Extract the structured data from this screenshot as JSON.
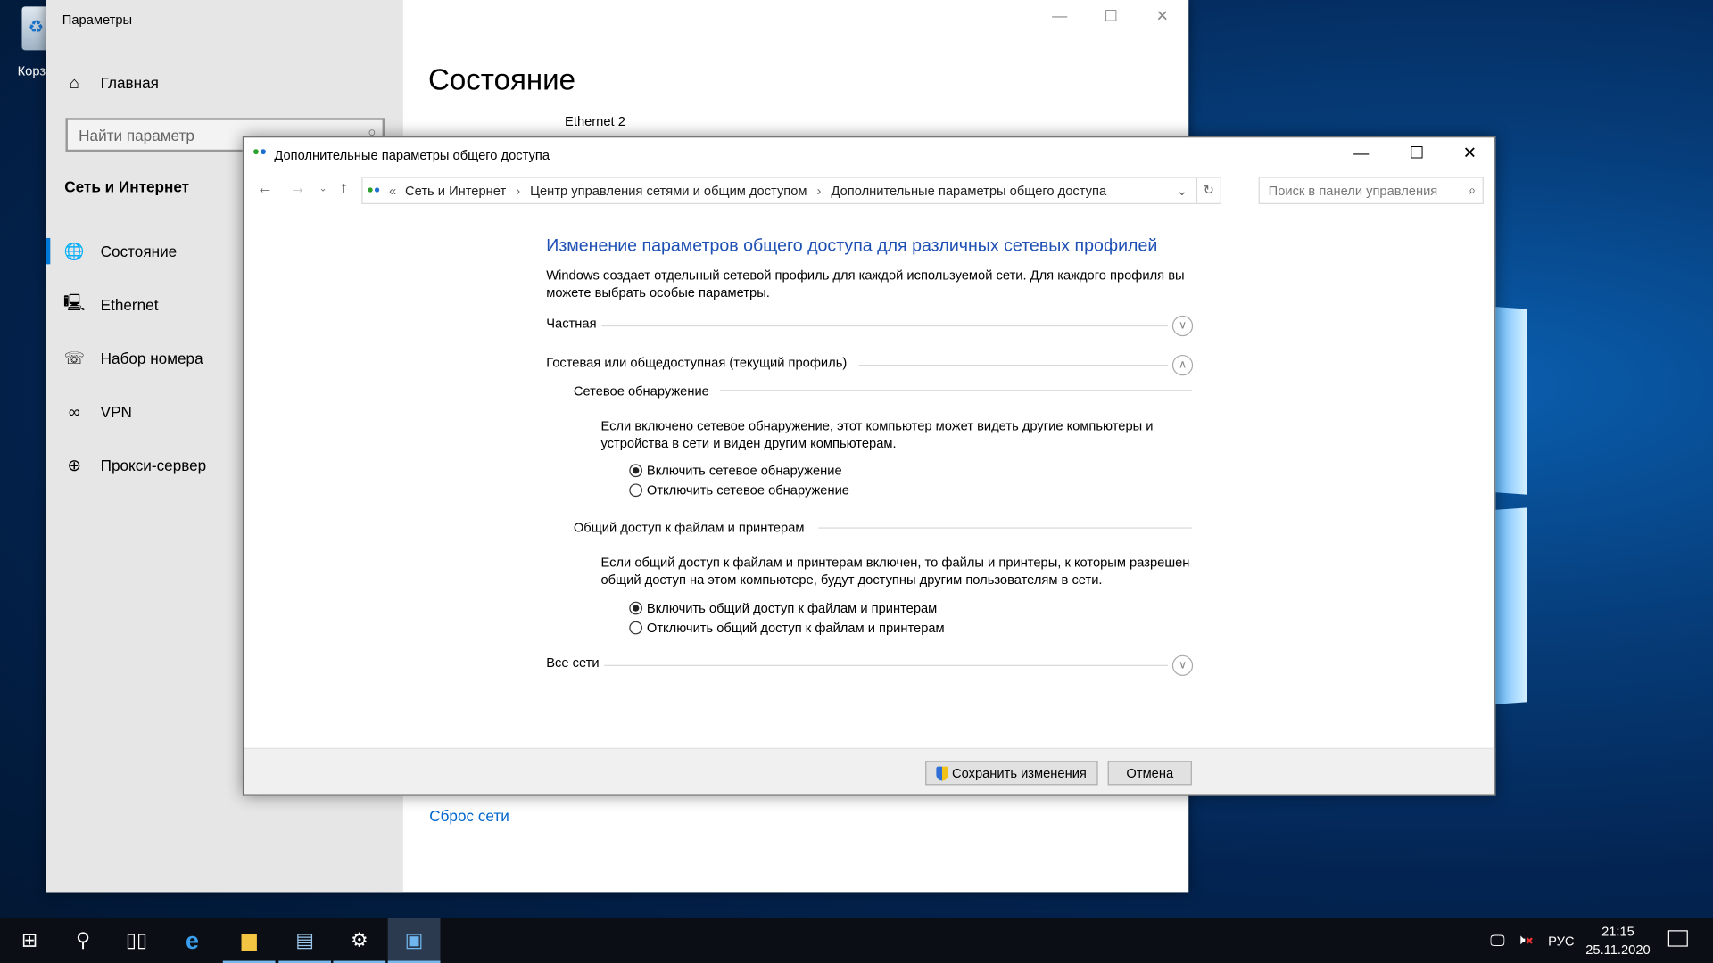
{
  "desktop": {
    "recycle_bin_label": "Корз"
  },
  "settings": {
    "title": "Параметры",
    "home": "Главная",
    "search_placeholder": "Найти параметр",
    "section": "Сеть и Интернет",
    "nav": [
      {
        "label": "Состояние",
        "icon": "globe-monitor-icon",
        "selected": true
      },
      {
        "label": "Ethernet",
        "icon": "ethernet-icon"
      },
      {
        "label": "Набор номера",
        "icon": "dialup-icon"
      },
      {
        "label": "VPN",
        "icon": "vpn-icon"
      },
      {
        "label": "Прокси-сервер",
        "icon": "globe-icon"
      }
    ],
    "page_title": "Состояние",
    "network_name": "Ethernet 2",
    "reset_link": "Сброс сети"
  },
  "dialog": {
    "title": "Дополнительные параметры общего доступа",
    "breadcrumb": [
      "Сеть и Интернет",
      "Центр управления сетями и общим доступом",
      "Дополнительные параметры общего доступа"
    ],
    "search_placeholder": "Поиск в панели управления",
    "heading": "Изменение параметров общего доступа для различных сетевых профилей",
    "intro": "Windows создает отдельный сетевой профиль для каждой используемой сети. Для каждого профиля вы можете выбрать особые параметры.",
    "profiles": {
      "private": "Частная",
      "guest": "Гостевая или общедоступная (текущий профиль)",
      "all": "Все сети"
    },
    "discovery": {
      "title": "Сетевое обнаружение",
      "desc": "Если включено сетевое обнаружение, этот компьютер может видеть другие компьютеры и устройства в сети и виден другим компьютерам.",
      "on": "Включить сетевое обнаружение",
      "off": "Отключить сетевое обнаружение",
      "selected": "on"
    },
    "sharing": {
      "title": "Общий доступ к файлам и принтерам",
      "desc": "Если общий доступ к файлам и принтерам включен, то файлы и принтеры, к которым разрешен общий доступ на этом компьютере, будут доступны другим пользователям в сети.",
      "on": "Включить общий доступ к файлам и принтерам",
      "off": "Отключить общий доступ к файлам и принтерам",
      "selected": "on"
    },
    "save": "Сохранить изменения",
    "cancel": "Отмена"
  },
  "taskbar": {
    "lang": "РУС",
    "time": "21:15",
    "date": "25.11.2020"
  },
  "colors": {
    "accent": "#0078d7",
    "heading": "#1e50b4",
    "link": "#0066cc"
  }
}
